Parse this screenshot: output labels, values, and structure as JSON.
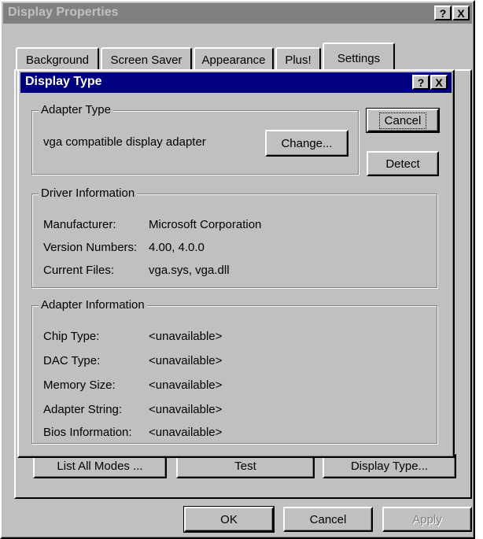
{
  "outer_window": {
    "title": "Display Properties",
    "help_button": "?",
    "close_button": "X"
  },
  "tabs": [
    {
      "label": "Background"
    },
    {
      "label": "Screen Saver"
    },
    {
      "label": "Appearance"
    },
    {
      "label": "Plus!"
    },
    {
      "label": "Settings"
    }
  ],
  "settings_buttons": {
    "list_all_modes": "List All Modes ...",
    "test": "Test",
    "display_type": "Display Type..."
  },
  "bottom_buttons": {
    "ok": "OK",
    "cancel": "Cancel",
    "apply": "Apply"
  },
  "dialog": {
    "title": "Display Type",
    "help_button": "?",
    "close_button": "X",
    "cancel_button": "Cancel",
    "detect_button": "Detect",
    "adapter_type": {
      "label": "Adapter Type",
      "value": "vga compatible display adapter",
      "change_button": "Change..."
    },
    "driver_info": {
      "label": "Driver Information",
      "rows": [
        {
          "key": "Manufacturer:",
          "value": "Microsoft Corporation"
        },
        {
          "key": "Version Numbers:",
          "value": "4.00, 4.0.0"
        },
        {
          "key": "Current Files:",
          "value": "vga.sys, vga.dll"
        }
      ]
    },
    "adapter_info": {
      "label": "Adapter Information",
      "rows": [
        {
          "key": "Chip Type:",
          "value": "<unavailable>"
        },
        {
          "key": "DAC Type:",
          "value": "<unavailable>"
        },
        {
          "key": "Memory Size:",
          "value": "<unavailable>"
        },
        {
          "key": "Adapter String:",
          "value": "<unavailable>"
        },
        {
          "key": "Bios Information:",
          "value": "<unavailable>"
        }
      ]
    }
  },
  "colors": {
    "inactive_title": "#808080",
    "active_title": "#000080",
    "face": "#c0c0c0"
  }
}
